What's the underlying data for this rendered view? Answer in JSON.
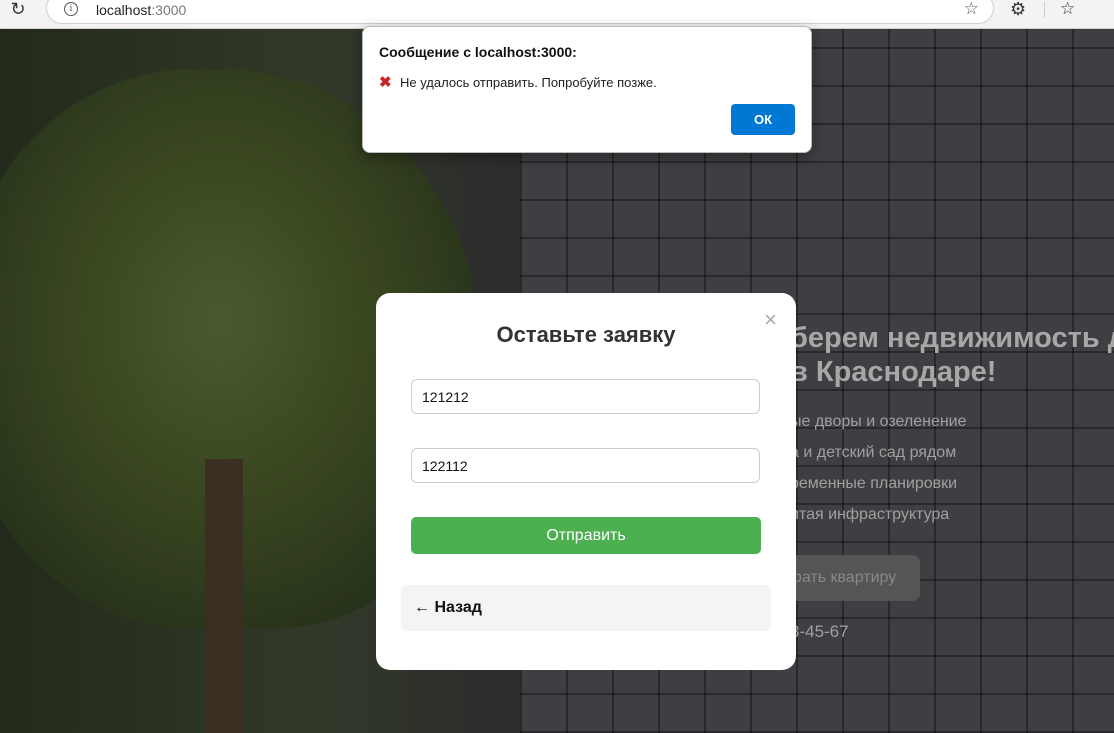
{
  "browser": {
    "url_host": "localhost",
    "url_port": ":3000"
  },
  "alert": {
    "title": "Сообщение с localhost:3000:",
    "message": "Не удалось отправить. Попробуйте позже.",
    "ok_label": "ОК"
  },
  "hero": {
    "title_line1": "берем недвижимость д",
    "title_line2": "в Краснодаре!",
    "features": [
      "ые дворы и озеленение",
      "а и детский сад рядом",
      "ременные планировки",
      "итая инфраструктура"
    ],
    "cta_label": "брать квартиру",
    "phone": "3-45-67"
  },
  "modal": {
    "title": "Оставьте заявку",
    "close_label": "×",
    "name_value": "121212",
    "phone_value": "122112",
    "submit_label": "Отправить",
    "back_label": "← Назад"
  }
}
